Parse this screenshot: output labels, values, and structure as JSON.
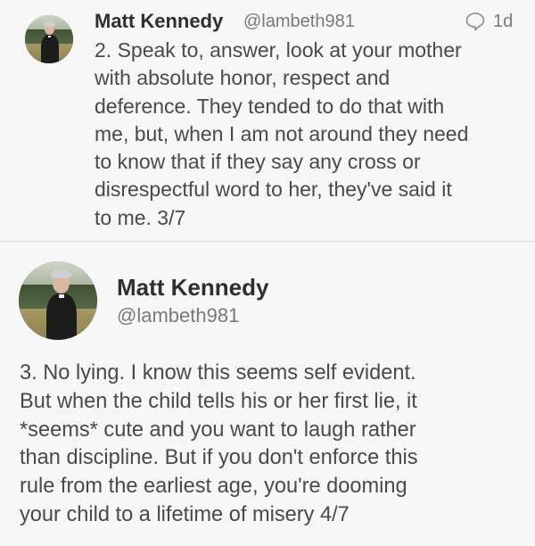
{
  "tweets": [
    {
      "author_name": "Matt Kennedy",
      "handle": "@lambeth981",
      "time": "1d",
      "reply_icon": "reply-bubble-icon",
      "text": "2. Speak to, answer, look at your mother\nwith absolute honor, respect and\ndeference. They tended to do that with\nme, but, when I am not around they need\nto know that if they say any cross or\ndisrespectful word to her, they've said it\nto me. 3/7"
    },
    {
      "author_name": "Matt Kennedy",
      "handle": "@lambeth981",
      "text": "3. No lying. I know this seems self evident.\nBut when the child tells his or her first lie, it\n*seems* cute and you want to laugh rather\nthan discipline. But if you don't enforce this\nrule from the earliest age, you're dooming\nyour child to a lifetime of misery 4/7"
    }
  ],
  "colors": {
    "background": "#f7f7f7",
    "name": "#2f2f2f",
    "meta": "#7a7a7a",
    "body_text": "#4a4a4a",
    "divider": "#d9d9d9"
  }
}
